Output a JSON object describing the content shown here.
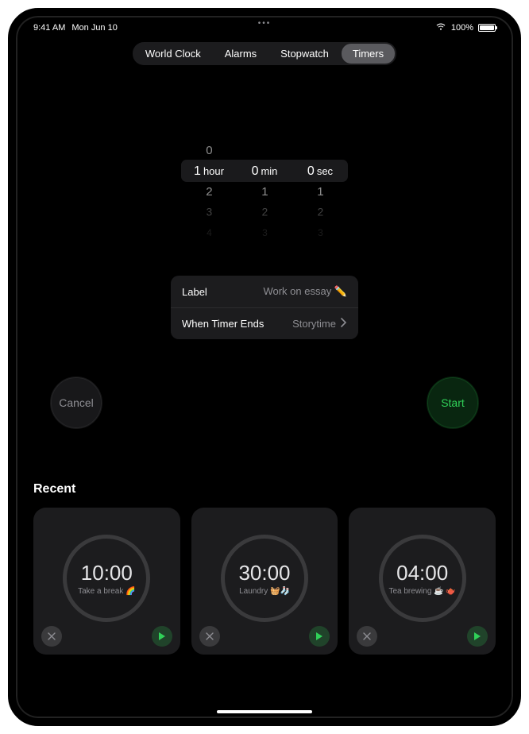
{
  "status": {
    "time": "9:41 AM",
    "date": "Mon Jun 10",
    "battery_pct": "100%"
  },
  "tabs": {
    "world_clock": "World Clock",
    "alarms": "Alarms",
    "stopwatch": "Stopwatch",
    "timers": "Timers"
  },
  "picker": {
    "hours": {
      "selected": "1",
      "unit": "hour",
      "above": [
        "0"
      ],
      "below": [
        "2",
        "3",
        "4"
      ]
    },
    "minutes": {
      "selected": "0",
      "unit": "min",
      "above": [],
      "below": [
        "1",
        "2",
        "3"
      ]
    },
    "seconds": {
      "selected": "0",
      "unit": "sec",
      "above": [],
      "below": [
        "1",
        "2",
        "3"
      ]
    }
  },
  "settings": {
    "label_key": "Label",
    "label_value": "Work on essay ✏️",
    "sound_key": "When Timer Ends",
    "sound_value": "Storytime"
  },
  "controls": {
    "cancel": "Cancel",
    "start": "Start"
  },
  "recent": {
    "title": "Recent",
    "items": [
      {
        "time": "10:00",
        "label": "Take a break 🌈"
      },
      {
        "time": "30:00",
        "label": "Laundry 🧺🧦"
      },
      {
        "time": "04:00",
        "label": "Tea brewing ☕️ 🫖"
      }
    ]
  }
}
